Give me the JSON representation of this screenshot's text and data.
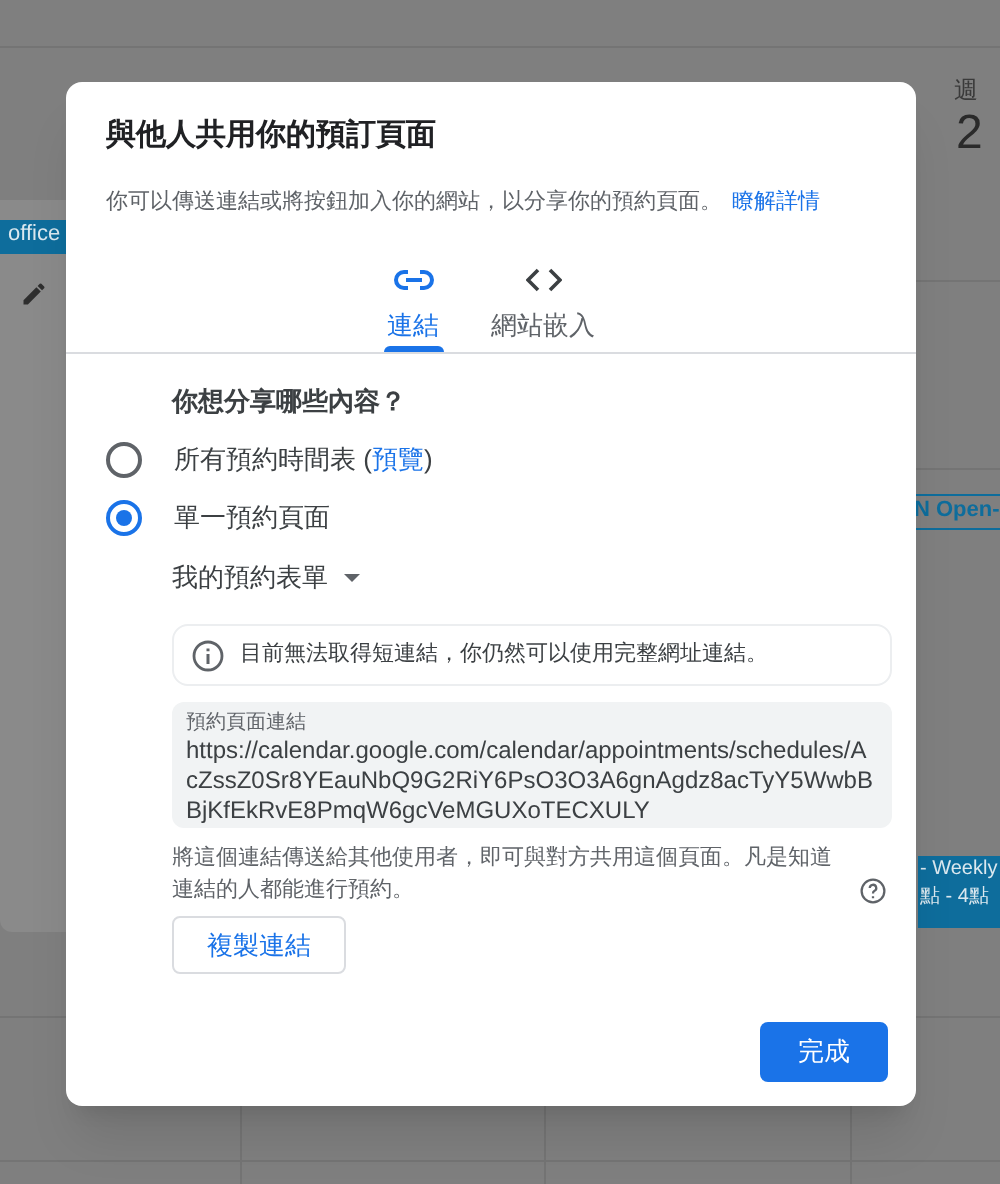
{
  "background": {
    "day_header": {
      "weekday": "週",
      "date": "2"
    },
    "events": [
      {
        "title": "office",
        "kind": "filled"
      },
      {
        "title": "N Open-",
        "kind": "outlined"
      },
      {
        "title": "- Weekly",
        "time": "點 - 4點",
        "kind": "filled"
      }
    ]
  },
  "dialog": {
    "title": "與他人共用你的預訂頁面",
    "description": "你可以傳送連結或將按鈕加入你的網站，以分享你的預約頁面。",
    "learn_more_link": "瞭解詳情",
    "tabs": [
      {
        "label": "連結",
        "selected": true
      },
      {
        "label": "網站嵌入",
        "selected": false
      }
    ],
    "question": "你想分享哪些內容？",
    "options": [
      {
        "label_before": "所有預約時間表 (",
        "link": "預覽",
        "label_after": ")",
        "selected": false
      },
      {
        "label_before": "單一預約頁面",
        "selected": true
      }
    ],
    "schedule_dropdown": "我的預約表單",
    "info_message": "目前無法取得短連結，你仍然可以使用完整網址連結。",
    "link_field": {
      "label": "預約頁面連結",
      "value": "https://calendar.google.com/calendar/appointments/schedules/AcZssZ0Sr8YEauNbQ9G2RiY6PsO3O3A6gnAgdz8acTyY5WwbBBjKfEkRvE8PmqW6gcVeMGUXoTECXULY"
    },
    "help_text": "將這個連結傳送給其他使用者，即可與對方共用這個頁面。凡是知道連結的人都能進行預約。",
    "copy_button": "複製連結",
    "done_button": "完成"
  }
}
